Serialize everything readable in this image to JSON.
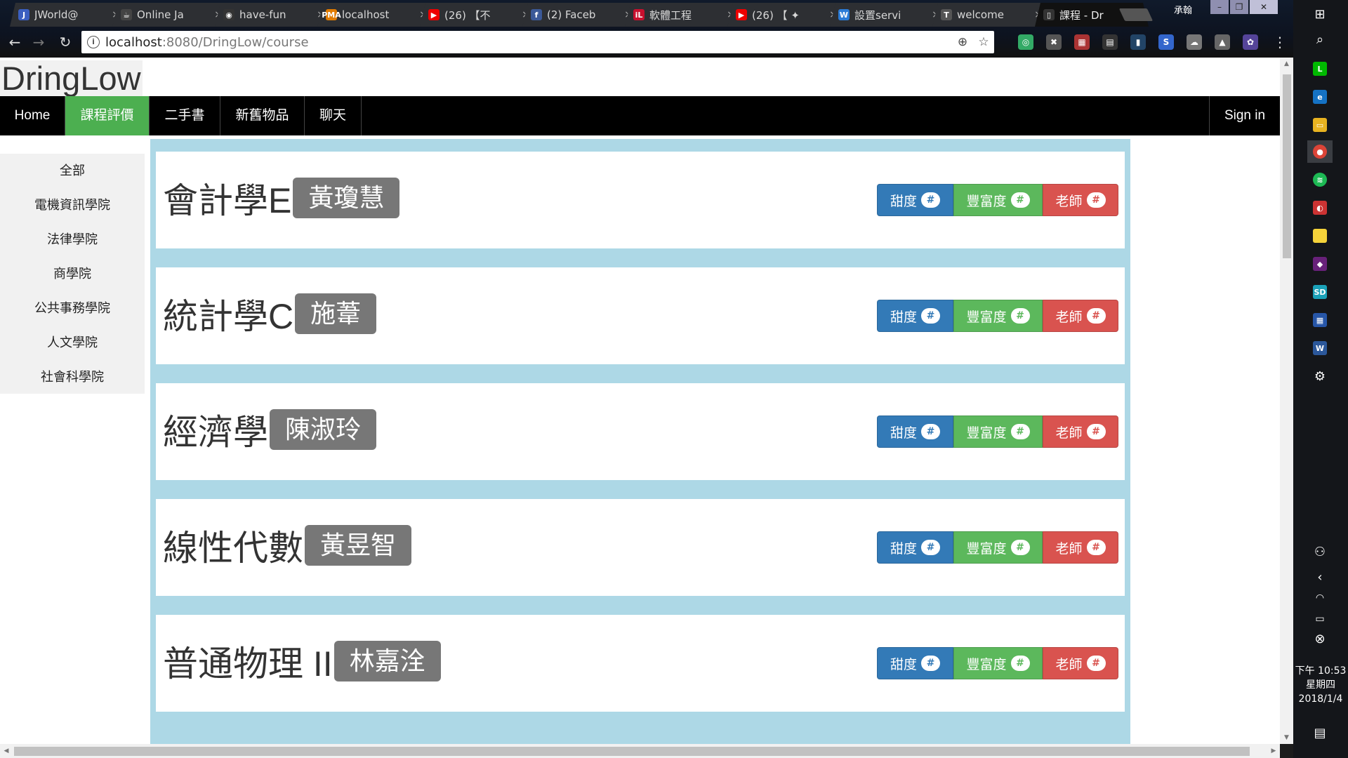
{
  "browser": {
    "tabs": [
      {
        "title": "JWorld@",
        "fav": "J",
        "fav_color": "#3b5fc0"
      },
      {
        "title": "Online Ja",
        "fav": "☕",
        "fav_color": "#444"
      },
      {
        "title": "have-fun",
        "fav": "◉",
        "fav_color": "#333"
      },
      {
        "title": "localhost",
        "fav": "PMA",
        "fav_color": "#e07b00"
      },
      {
        "title": "(26) 【不",
        "fav": "▶",
        "fav_color": "#e00"
      },
      {
        "title": "(2) Faceb",
        "fav": "f",
        "fav_color": "#3b5998"
      },
      {
        "title": "軟體工程",
        "fav": "iL",
        "fav_color": "#c8102e"
      },
      {
        "title": "(26) 【 ✦",
        "fav": "▶",
        "fav_color": "#e00"
      },
      {
        "title": "設置servi",
        "fav": "W",
        "fav_color": "#2b7bd6"
      },
      {
        "title": "welcome",
        "fav": "T",
        "fav_color": "#555"
      },
      {
        "title": "課程 - Dr",
        "fav": "▯",
        "fav_color": "#333"
      }
    ],
    "user_name": "承翰",
    "url_host": "localhost",
    "url_path": ":8080/DringLow/course"
  },
  "site": {
    "logo": "DringLow",
    "nav": [
      {
        "label": "Home",
        "name": "nav-home"
      },
      {
        "label": "課程評價",
        "name": "nav-course-review"
      },
      {
        "label": "二手書",
        "name": "nav-used-books"
      },
      {
        "label": "新舊物品",
        "name": "nav-items"
      },
      {
        "label": "聊天",
        "name": "nav-chat"
      }
    ],
    "signin": "Sign in",
    "accent_color": "#4caf50"
  },
  "sidebar": {
    "items": [
      "全部",
      "電機資訊學院",
      "法律學院",
      "商學院",
      "公共事務學院",
      "人文學院",
      "社會科學院"
    ]
  },
  "courses": [
    {
      "title": "會計學E",
      "teacher": "黃瓊慧"
    },
    {
      "title": "統計學C",
      "teacher": "施葦"
    },
    {
      "title": "經濟學",
      "teacher": "陳淑玲"
    },
    {
      "title": "線性代數",
      "teacher": "黃昱智"
    },
    {
      "title": "普通物理 II",
      "teacher": "林嘉洤"
    }
  ],
  "rating_buttons": {
    "sweet": "甜度",
    "rich": "豐富度",
    "teacher": "老師",
    "badge": "#"
  },
  "taskbar": {
    "time": "下午 10:53",
    "weekday": "星期四",
    "date": "2018/1/4"
  }
}
